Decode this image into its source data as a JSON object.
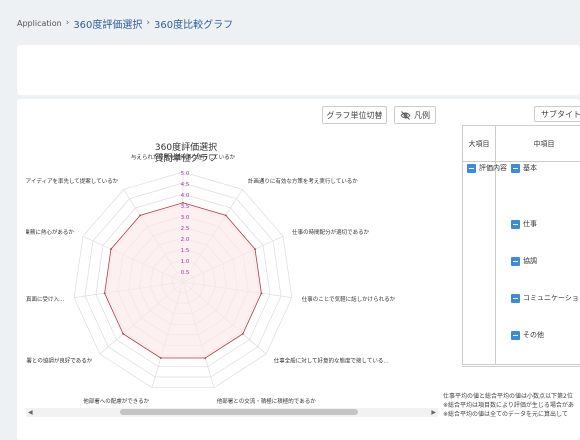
{
  "breadcrumb": {
    "app": "Application",
    "separator": "›",
    "level1": "360度評価選択",
    "level2": "360度比較グラフ"
  },
  "toolbar": {
    "unit_button": "グラフ単位切替",
    "legend_button": "凡例",
    "legend_icon": "eye-off-icon"
  },
  "chart_data": {
    "type": "radar",
    "title": "360度評価選択",
    "subtitle": "質問単位グラフ",
    "rmin": 0,
    "rmax": 5,
    "ticks": [
      "0.5",
      "1.0",
      "1.5",
      "2.0",
      "2.5",
      "3.0",
      "3.5",
      "4.0",
      "4.5",
      "5.0"
    ],
    "axes": [
      "与えられた役割を期待通り遂行しているか",
      "計画通りに有効な方策を考え実行しているか",
      "仕事の時間配分が適切であるか",
      "仕事のことで気軽に話しかけられるか",
      "仕事全般に対して好意的な態度で接している...",
      "他部署との交流・積極に積極的であるか",
      "他部署への配慮ができるか",
      "部署との協調が良好であるか",
      "...を真面に受け入...",
      "...業務に熱心があるか",
      "...のアイディアを率先して提案しているか"
    ],
    "series": [
      {
        "values": [
          3.6,
          3.6,
          3.6,
          3.6,
          3.6,
          3.6,
          3.6,
          3.6,
          3.6,
          3.6,
          3.6
        ],
        "color": "#b23a48"
      }
    ],
    "grid": true,
    "colors": {
      "grid": "#dddddd",
      "tick": "#9b3fb0",
      "series": "#b23a48",
      "fill": "#fbeaea"
    }
  },
  "table": {
    "subtitle_button": "サブタイトル",
    "col_large": "大項目",
    "col_mid": "中項目",
    "large_item": "評価内容",
    "mid_items": [
      "基本",
      "仕事",
      "協調",
      "コミュニケーション",
      "その他"
    ]
  },
  "notes": [
    "仕事平均の値と総合平均の値は小数点以下第2位",
    "※総合平均は項目数により評価が生じる場合があ",
    "※総合平均の値は全てのデータを元に算出して"
  ]
}
